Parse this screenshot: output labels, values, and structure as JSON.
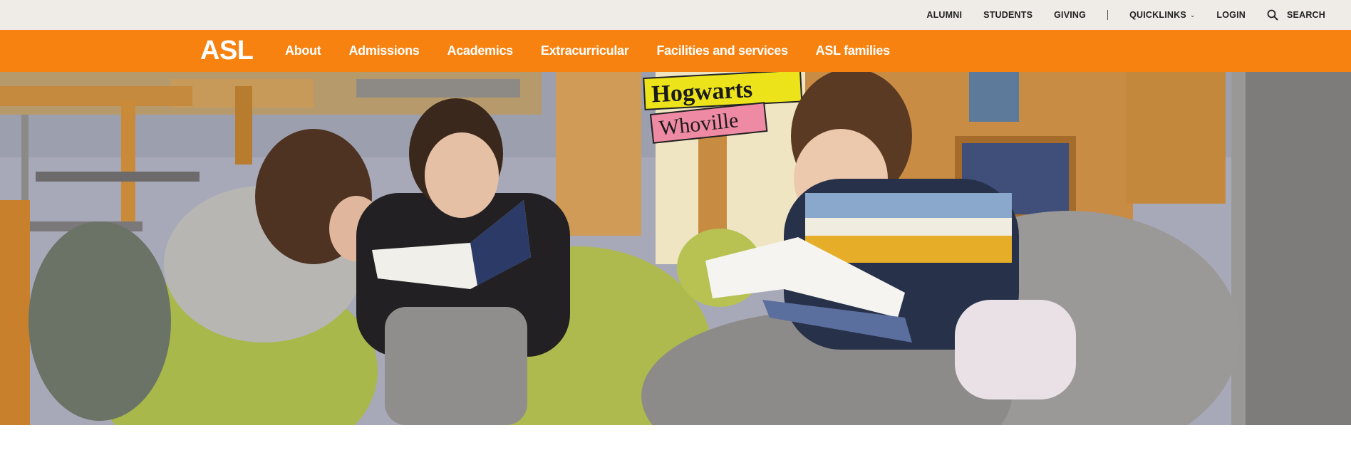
{
  "utility": {
    "alumni": "ALUMNI",
    "students": "STUDENTS",
    "giving": "GIVING",
    "quicklinks": "QUICKLINKS",
    "login": "LOGIN",
    "search": "SEARCH"
  },
  "brand": {
    "logo": "ASL"
  },
  "nav": {
    "about": "About",
    "admissions": "Admissions",
    "academics": "Academics",
    "extracurricular": "Extracurricular",
    "facilities": "Facilities and services",
    "families": "ASL families"
  },
  "hero": {
    "sign_top": "Hogwarts",
    "sign_bottom": "Whoville"
  },
  "colors": {
    "brand_orange": "#f77d06",
    "utility_bg": "#efebe7"
  },
  "icons": {
    "search": "search-icon",
    "quicklinks_chevron": "chevron-down-icon"
  }
}
